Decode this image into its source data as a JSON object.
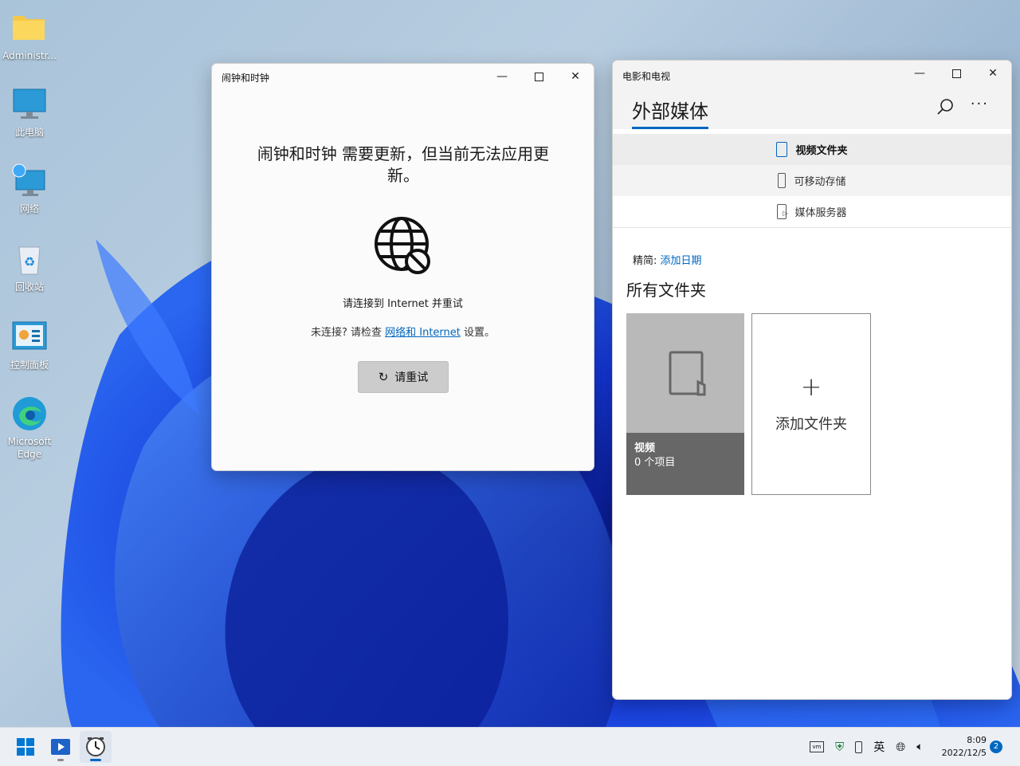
{
  "desktop": {
    "icons": [
      {
        "label": "Administr..."
      },
      {
        "label": "此电脑"
      },
      {
        "label": "网络"
      },
      {
        "label": "回收站"
      },
      {
        "label": "控制面板"
      },
      {
        "label": "Microsoft Edge"
      }
    ]
  },
  "clock_window": {
    "title": "闹钟和时钟",
    "message": "闹钟和时钟 需要更新，但当前无法应用更新。",
    "connect_prompt": "请连接到 Internet 并重试",
    "not_connected_prefix": "未连接? 请检查",
    "network_link": "网络和 Internet",
    "not_connected_suffix": "设置。",
    "retry_label": "请重试",
    "icon": "globe-blocked-icon"
  },
  "movies_window": {
    "title": "电影和电视",
    "header": "外部媒体",
    "nav": [
      {
        "label": "视频文件夹",
        "selected": true,
        "icon": "device-icon"
      },
      {
        "label": "可移动存储",
        "selected": false,
        "icon": "usb-icon"
      },
      {
        "label": "媒体服务器",
        "selected": false,
        "icon": "media-server-icon"
      }
    ],
    "filter_label": "精简:",
    "filter_value": "添加日期",
    "section_title": "所有文件夹",
    "folder_tile": {
      "name": "视频",
      "count": "0 个项目"
    },
    "add_tile": {
      "label": "添加文件夹"
    }
  },
  "taskbar": {
    "time": "8:09",
    "date": "2022/12/5",
    "ime": "英",
    "notifications": "2"
  },
  "colors": {
    "accent": "#0067c0",
    "link": "#0067c0"
  }
}
